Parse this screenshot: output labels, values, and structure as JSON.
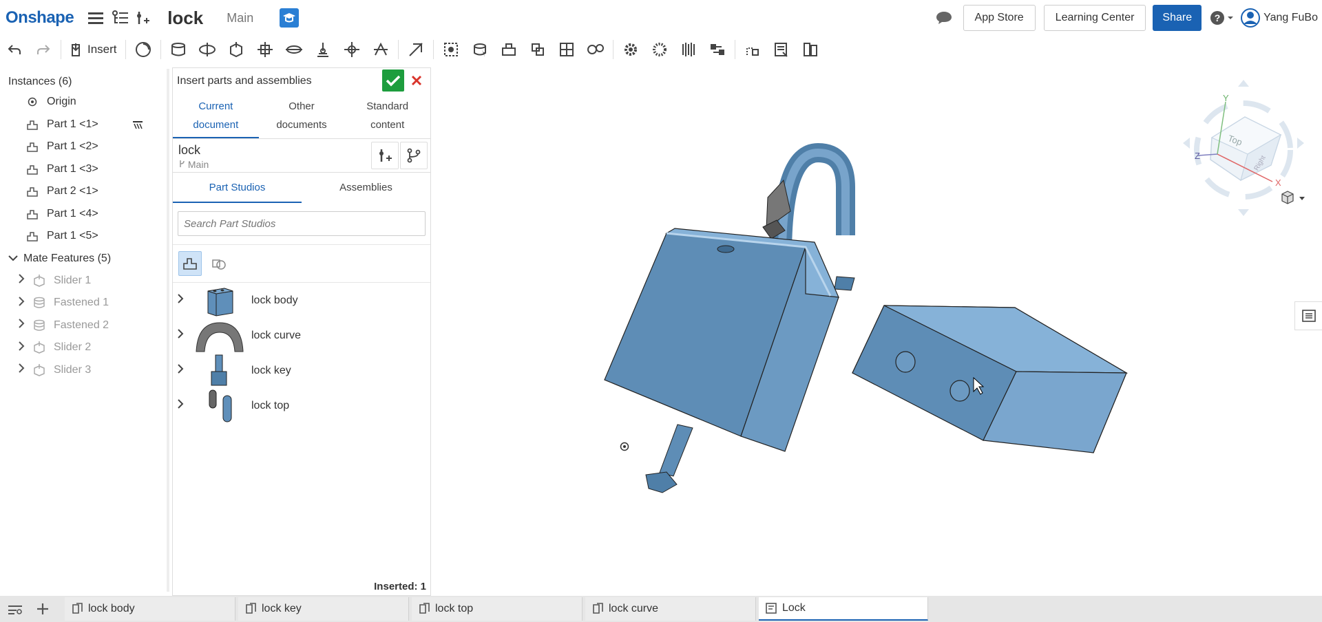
{
  "header": {
    "logo": "Onshape",
    "doc_title": "lock",
    "branch": "Main",
    "app_store": "App Store",
    "learning_center": "Learning Center",
    "share": "Share",
    "user_name": "Yang FuBo"
  },
  "toolbar": {
    "insert_label": "Insert"
  },
  "instances": {
    "title": "Instances (6)",
    "items": [
      {
        "label": "Origin",
        "icon": "origin-icon"
      },
      {
        "label": "Part 1 <1>",
        "icon": "part-icon"
      },
      {
        "label": "Part 1 <2>",
        "icon": "part-icon"
      },
      {
        "label": "Part 1 <3>",
        "icon": "part-icon"
      },
      {
        "label": "Part 2 <1>",
        "icon": "part-icon"
      },
      {
        "label": "Part 1 <4>",
        "icon": "part-icon"
      },
      {
        "label": "Part 1 <5>",
        "icon": "part-icon"
      }
    ],
    "mate_group": "Mate Features (5)",
    "mates": [
      {
        "label": "Slider 1",
        "icon": "slider-mate-icon"
      },
      {
        "label": "Fastened 1",
        "icon": "fastened-mate-icon"
      },
      {
        "label": "Fastened 2",
        "icon": "fastened-mate-icon"
      },
      {
        "label": "Slider 2",
        "icon": "slider-mate-icon"
      },
      {
        "label": "Slider 3",
        "icon": "slider-mate-icon"
      }
    ]
  },
  "insert_dialog": {
    "title": "Insert parts and assemblies",
    "source_tabs": [
      {
        "line1": "Current",
        "line2": "document"
      },
      {
        "line1": "Other",
        "line2": "documents"
      },
      {
        "line1": "Standard",
        "line2": "content"
      }
    ],
    "doc_name": "lock",
    "doc_branch": "Main",
    "sub_tabs": [
      "Part Studios",
      "Assemblies"
    ],
    "search_placeholder": "Search Part Studios",
    "part_studios": [
      "lock body",
      "lock curve",
      "lock key",
      "lock top"
    ],
    "inserted": "Inserted: 1"
  },
  "view_cube": {
    "face_top": "Top",
    "face_right": "Right",
    "axis_x": "X",
    "axis_y": "Y",
    "axis_z": "Z"
  },
  "bottom_tabs": [
    {
      "label": "lock body",
      "type": "part-studio"
    },
    {
      "label": "lock key",
      "type": "part-studio"
    },
    {
      "label": "lock top",
      "type": "part-studio"
    },
    {
      "label": "lock curve",
      "type": "part-studio"
    },
    {
      "label": "Lock",
      "type": "assembly",
      "active": true
    }
  ],
  "colors": {
    "brand": "#1a62b3",
    "part_fill": "#7ba8cf",
    "confirm": "#1d9d3e",
    "cancel": "#d9342b"
  }
}
